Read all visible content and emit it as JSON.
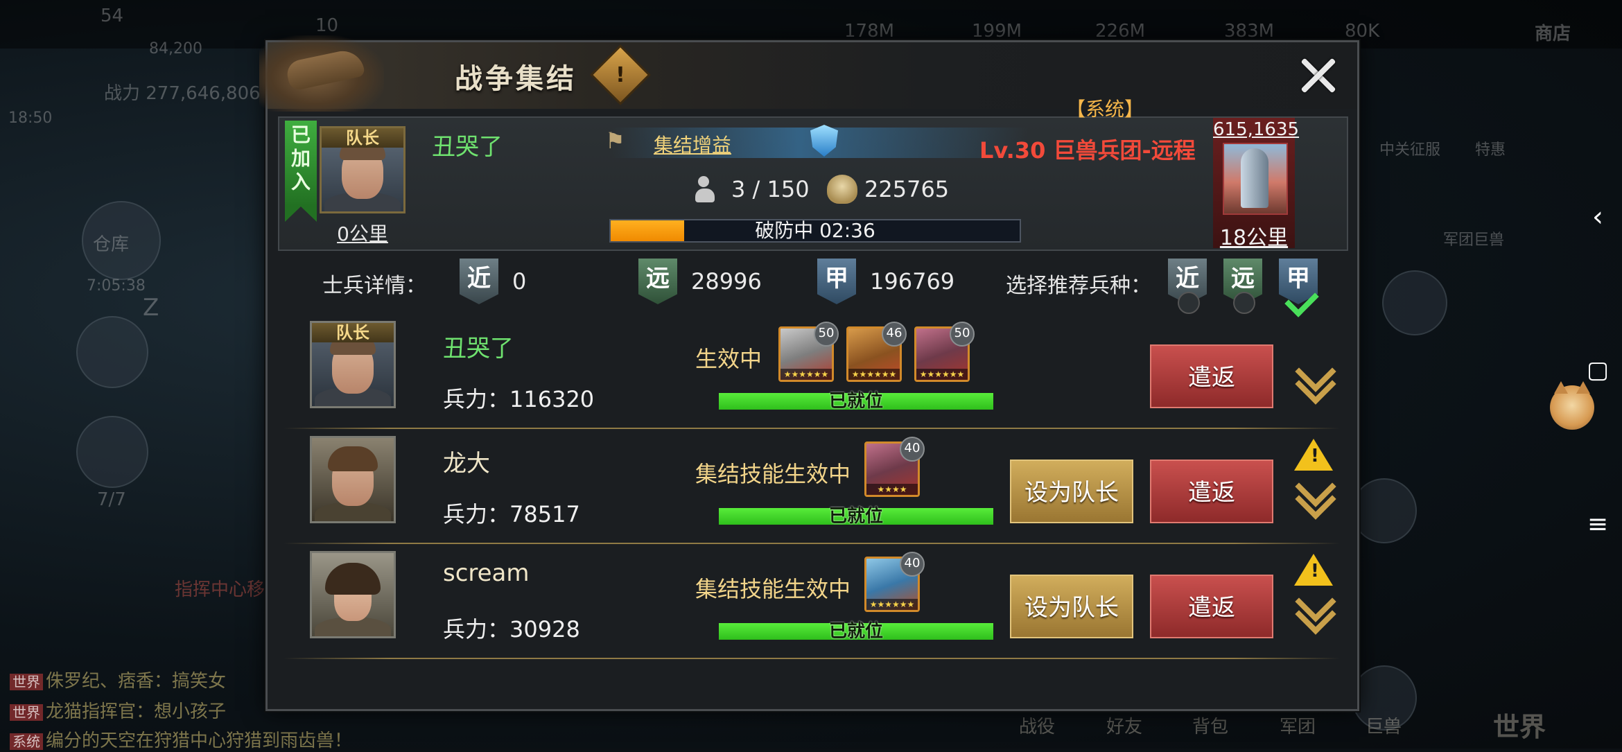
{
  "background": {
    "top_values": [
      "54",
      "10",
      "84,200",
      "178M",
      "199M",
      "226M",
      "383M",
      "80K"
    ],
    "combat_power": "战力 277,646,806",
    "time": "18:50",
    "left_labels": [
      "仓库",
      "7/7",
      "Z"
    ],
    "timer": "7:05:38",
    "shop_label": "商店",
    "right_labels": [
      "中关征服",
      "特惠",
      "军团巨兽"
    ],
    "command_center": "指挥中心移",
    "chat": [
      {
        "tag": "世界",
        "text": "侏罗纪、痞香：搞笑女"
      },
      {
        "tag": "世界",
        "text": "龙猫指挥官：想小孩子"
      },
      {
        "tag": "系统",
        "text": "编分的天空在狩猎中心狩猎到雨齿兽！"
      }
    ],
    "bottom_nav": [
      "战役",
      "好友",
      "背包",
      "军团",
      "巨兽",
      "世界"
    ]
  },
  "dialog": {
    "title": "战争集结",
    "badge_glyph": "!"
  },
  "summary": {
    "joined_label": "已加入",
    "captain_tag": "队长",
    "leader_distance": "0公里",
    "leader_name": "丑哭了",
    "rally_bonus": "集结增益",
    "troop_count": "3 / 150",
    "power": "225765",
    "progress_label": "破防中  02:36",
    "progress_fraction": 0.18,
    "system_tag": "【系统】",
    "target_name": "Lv.30 巨兽兵团-远程",
    "target_coord": "615,1635",
    "target_distance": "18公里"
  },
  "soldier_details": {
    "label": "士兵详情：",
    "melee_glyph": "近",
    "melee_value": "0",
    "ranged_glyph": "远",
    "ranged_value": "28996",
    "armor_glyph": "甲",
    "armor_value": "196769",
    "recommend_label": "选择推荐兵种：",
    "recommend_options": [
      "近",
      "远",
      "甲"
    ],
    "recommend_selected": "甲"
  },
  "members": [
    {
      "captain_tag": "队长",
      "name": "丑哭了",
      "power": "兵力：116320",
      "status": "生效中",
      "heroes": [
        {
          "icon": "robot-hero",
          "level": "50",
          "stars": "★★★★★★"
        },
        {
          "icon": "croc-hero",
          "level": "46",
          "stars": "★★★★★★"
        },
        {
          "icon": "ape-hero",
          "level": "50",
          "stars": "★★★★★★"
        }
      ],
      "ready_label": "已就位",
      "return_label": "遣返"
    },
    {
      "name": "龙大",
      "power": "兵力：78517",
      "status": "集结技能生效中",
      "heroes": [
        {
          "icon": "ape-hero",
          "level": "40",
          "stars": "★★★★"
        }
      ],
      "ready_label": "已就位",
      "set_captain_label": "设为队长",
      "return_label": "遣返"
    },
    {
      "name": "scream",
      "power": "兵力：30928",
      "status": "集结技能生效中",
      "heroes": [
        {
          "icon": "raptor-hero",
          "level": "40",
          "stars": "★★★★★★"
        }
      ],
      "ready_label": "已就位",
      "set_captain_label": "设为队长",
      "return_label": "遣返"
    }
  ],
  "colors": {
    "leader_name": "#6fe26f",
    "target_name": "#f24a3a",
    "progress_fill": "#f08a00",
    "ready_bar": "#2fbf1c",
    "return_button": "#c9504e",
    "set_captain_button": "#d1ad5c"
  }
}
